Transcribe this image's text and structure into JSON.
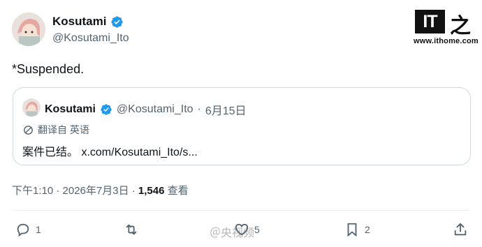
{
  "tweet": {
    "author": {
      "name": "Kosutami",
      "handle": "@Kosutami_Ito",
      "verified": true
    },
    "text": "*Suspended.",
    "quoted": {
      "author": "Kosutami",
      "handle": "@Kosutami_Ito",
      "date": "6月15日",
      "translate_label": "翻译自 英语",
      "text": "案件已结。 x.com/Kosutami_Ito/s..."
    },
    "timestamp": "下午1:10 · 2026年7月3日 · ",
    "views_count": "1,546",
    "views_label": " 查看"
  },
  "actions": {
    "reply": {
      "icon": "reply-icon",
      "count": "1"
    },
    "retweet": {
      "icon": "retweet-icon",
      "count": ""
    },
    "like": {
      "icon": "heart-icon",
      "count": "5"
    },
    "bookmark": {
      "icon": "bookmark-icon",
      "count": "2"
    },
    "share": {
      "icon": "share-icon",
      "count": ""
    }
  },
  "branding": {
    "logo_text": "IT",
    "logo_char": "之",
    "site": "www.ithome.com"
  },
  "watermark": {
    "text": "＠央视频"
  },
  "colors": {
    "verified": "#1d9bf0",
    "text": "#0f1419",
    "secondary": "#536471",
    "border": "#cfd9de"
  }
}
